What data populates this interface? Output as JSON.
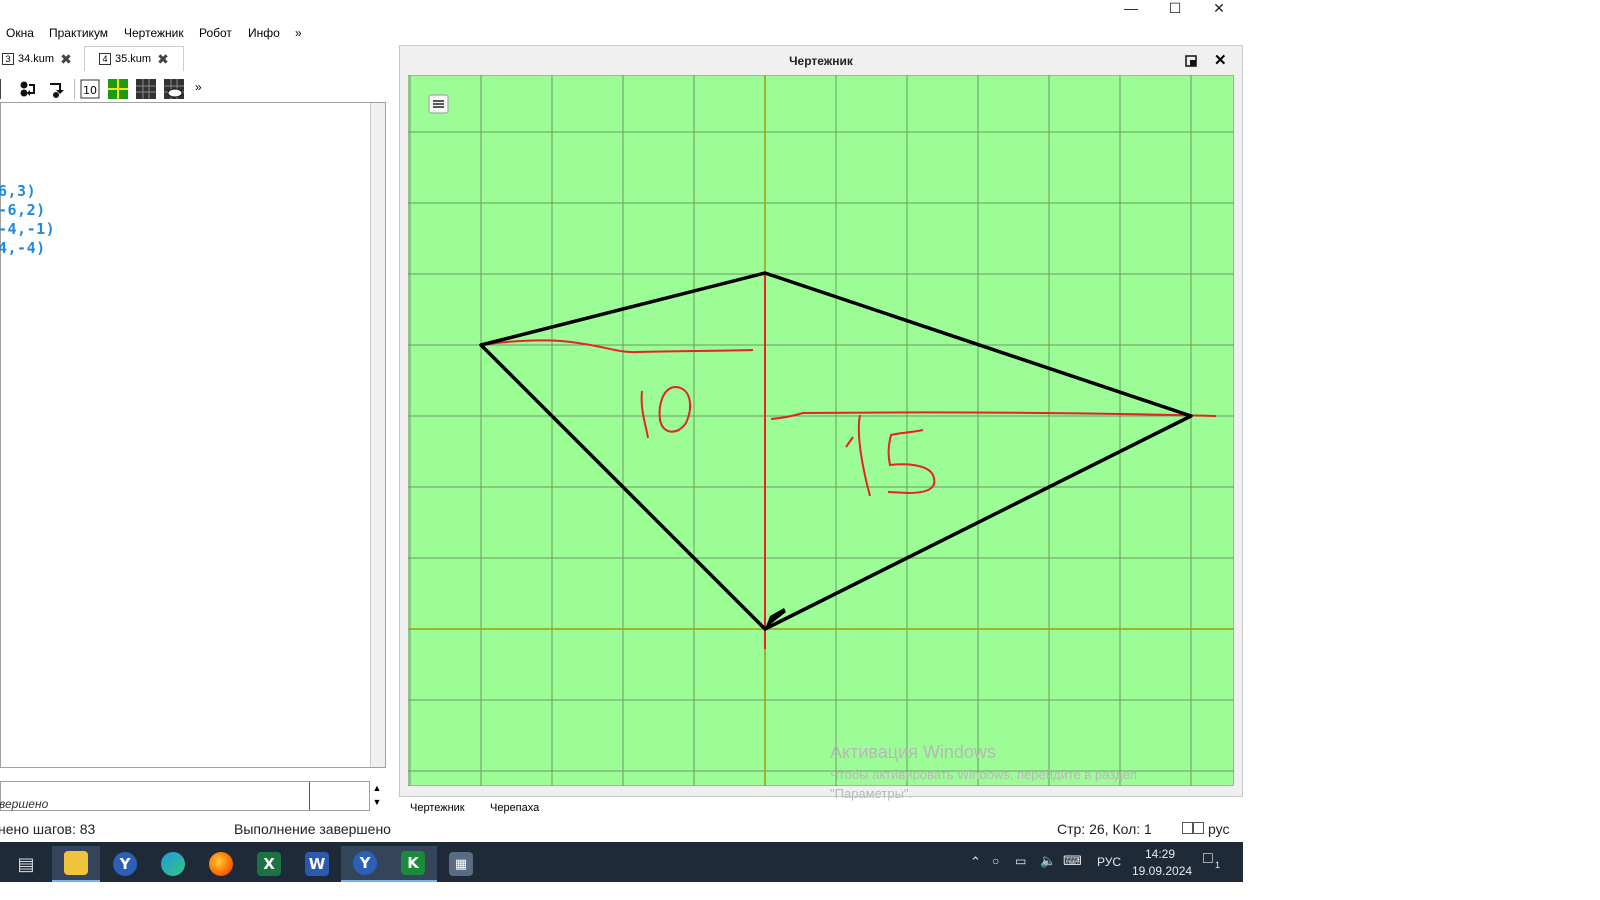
{
  "menu": [
    "Окна",
    "Практикум",
    "Чертежник",
    "Робот",
    "Инфо",
    "»"
  ],
  "tabs": [
    {
      "num": "3",
      "label": "34.kum"
    },
    {
      "num": "4",
      "label": "35.kum"
    }
  ],
  "toolbar": {
    "more": "»"
  },
  "code_lines": [
    "6,3)",
    "-6,2)",
    "-4,-1)",
    "4,-4)"
  ],
  "output_text": "вершено",
  "status": {
    "steps": "нено шагов: 83",
    "message": "Выполнение завершено",
    "position": "Стр: 26, Кол: 1",
    "lang": "рус"
  },
  "drawer": {
    "title": "Чертежник",
    "tabs": [
      "Чертежник",
      "Черепаха"
    ],
    "annotations": [
      "10",
      "15"
    ]
  },
  "watermark": {
    "title": "Активация Windows",
    "line1": "Чтобы активировать Windows, перейдите в раздел",
    "line2": "\"Параметры\"."
  },
  "taskbar": {
    "apps": [
      "task-view",
      "file-explorer",
      "yandex-browser",
      "edge",
      "firefox",
      "excel",
      "word",
      "yandex-browser",
      "kumir",
      "calculator"
    ],
    "lang": "РУС",
    "time": "14:29",
    "date": "19.09.2024",
    "notifications": "1"
  },
  "colors": {
    "canvas_bg": "#9cfd97",
    "grid": "#6a9a66",
    "axes": "#a0a000",
    "figure": "#000000",
    "annotation": "#e8202a",
    "code": "#1e8adf"
  }
}
